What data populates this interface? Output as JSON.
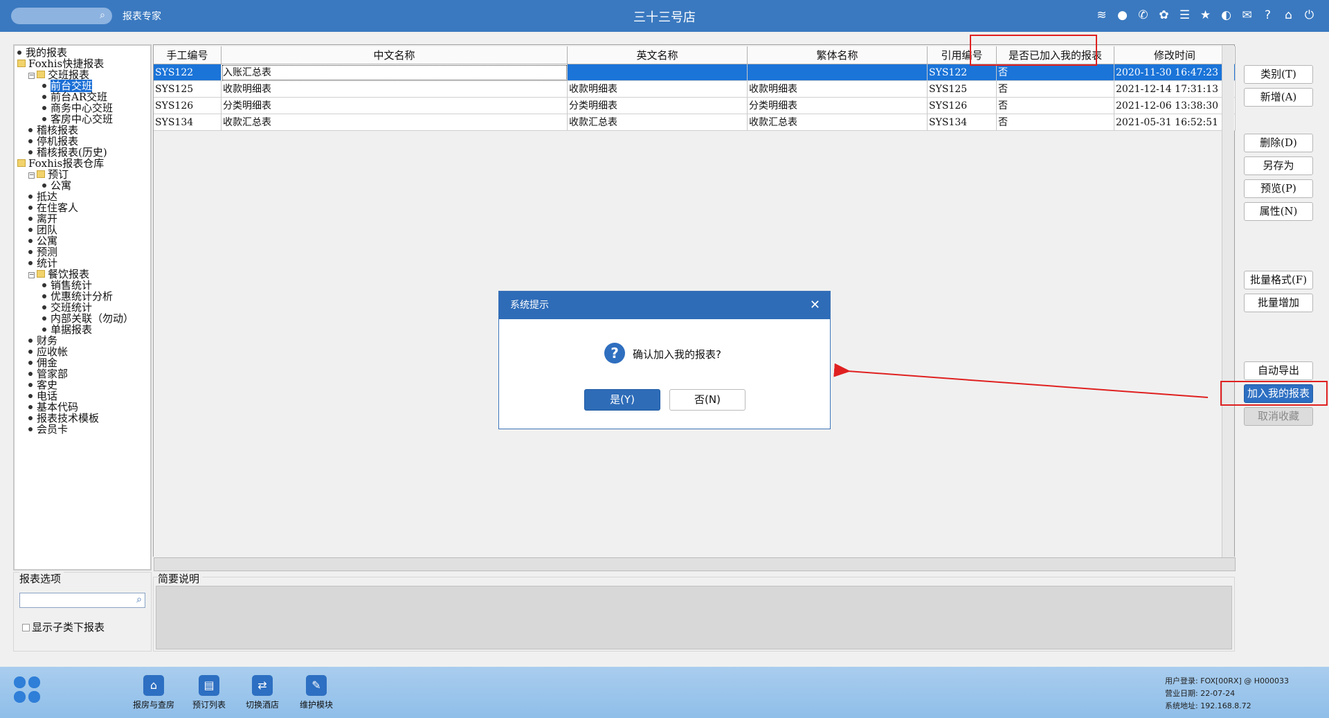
{
  "topbar": {
    "app_name": "报表专家",
    "hotel_name": "三十三号店",
    "icons": [
      "wifi-icon",
      "chat-icon",
      "phone-icon",
      "palette-icon",
      "menu-icon",
      "star-icon",
      "theme-icon",
      "mail-icon",
      "help-icon",
      "home-icon",
      "power-icon"
    ]
  },
  "tree": {
    "items": [
      {
        "label": "我的报表",
        "level": 0,
        "type": "leaf"
      },
      {
        "label": "Foxhis快捷报表",
        "level": 0,
        "type": "folder"
      },
      {
        "label": "交班报表",
        "level": 1,
        "type": "folder-open"
      },
      {
        "label": "前台交班",
        "level": 2,
        "type": "leaf",
        "selected": true
      },
      {
        "label": "前台AR交班",
        "level": 2,
        "type": "leaf"
      },
      {
        "label": "商务中心交班",
        "level": 2,
        "type": "leaf"
      },
      {
        "label": "客房中心交班",
        "level": 2,
        "type": "leaf"
      },
      {
        "label": "稽核报表",
        "level": 1,
        "type": "leaf"
      },
      {
        "label": "停机报表",
        "level": 1,
        "type": "leaf"
      },
      {
        "label": "稽核报表(历史)",
        "level": 1,
        "type": "leaf"
      },
      {
        "label": "Foxhis报表仓库",
        "level": 0,
        "type": "folder"
      },
      {
        "label": "预订",
        "level": 1,
        "type": "folder-open"
      },
      {
        "label": "公寓",
        "level": 2,
        "type": "leaf"
      },
      {
        "label": "抵达",
        "level": 1,
        "type": "leaf"
      },
      {
        "label": "在住客人",
        "level": 1,
        "type": "leaf"
      },
      {
        "label": "离开",
        "level": 1,
        "type": "leaf"
      },
      {
        "label": "团队",
        "level": 1,
        "type": "leaf"
      },
      {
        "label": "公寓",
        "level": 1,
        "type": "leaf"
      },
      {
        "label": "预测",
        "level": 1,
        "type": "leaf"
      },
      {
        "label": "统计",
        "level": 1,
        "type": "leaf"
      },
      {
        "label": "餐饮报表",
        "level": 1,
        "type": "folder-open"
      },
      {
        "label": "销售统计",
        "level": 2,
        "type": "leaf"
      },
      {
        "label": "优惠统计分析",
        "level": 2,
        "type": "leaf"
      },
      {
        "label": "交班统计",
        "level": 2,
        "type": "leaf"
      },
      {
        "label": "内部关联（勿动）",
        "level": 2,
        "type": "leaf"
      },
      {
        "label": "单据报表",
        "level": 2,
        "type": "leaf"
      },
      {
        "label": "财务",
        "level": 1,
        "type": "leaf"
      },
      {
        "label": "应收帐",
        "level": 1,
        "type": "leaf"
      },
      {
        "label": "佣金",
        "level": 1,
        "type": "leaf"
      },
      {
        "label": "管家部",
        "level": 1,
        "type": "leaf"
      },
      {
        "label": "客史",
        "level": 1,
        "type": "leaf"
      },
      {
        "label": "电话",
        "level": 1,
        "type": "leaf"
      },
      {
        "label": "基本代码",
        "level": 1,
        "type": "leaf"
      },
      {
        "label": "报表技术模板",
        "level": 1,
        "type": "leaf"
      },
      {
        "label": "会员卡",
        "level": 1,
        "type": "leaf"
      }
    ]
  },
  "grid": {
    "columns": [
      "手工编号",
      "中文名称",
      "英文名称",
      "繁体名称",
      "引用编号",
      "是否已加入我的报表",
      "修改时间"
    ],
    "rows": [
      [
        "SYS122",
        "入账汇总表",
        "",
        "",
        "SYS122",
        "否",
        "2020-11-30 16:47:23"
      ],
      [
        "SYS125",
        "收款明细表",
        "收款明细表",
        "收款明细表",
        "SYS125",
        "否",
        "2021-12-14 17:31:13"
      ],
      [
        "SYS126",
        "分类明细表",
        "分类明细表",
        "分类明细表",
        "SYS126",
        "否",
        "2021-12-06 13:38:30"
      ],
      [
        "SYS134",
        "收款汇总表",
        "收款汇总表",
        "收款汇总表",
        "SYS134",
        "否",
        "2021-05-31 16:52:51"
      ]
    ]
  },
  "buttons": {
    "category": "类别(T)",
    "add": "新增(A)",
    "delete": "删除(D)",
    "save_as": "另存为",
    "preview": "预览(P)",
    "properties": "属性(N)",
    "batch_format": "批量格式(F)",
    "batch_add": "批量增加",
    "auto_export": "自动导出",
    "add_to_my_reports": "加入我的报表",
    "unfavorite": "取消收藏"
  },
  "options": {
    "label": "报表选项",
    "search_value": "",
    "show_sub_label": "显示子类下报表"
  },
  "description": {
    "label": "简要说明"
  },
  "footer": {
    "items": [
      "报房与查房",
      "预订列表",
      "切换酒店",
      "维护模块"
    ],
    "status": {
      "user": "用户登录:  FOX[00RX] @ H000033",
      "date": "营业日期:  22-07-24",
      "address": "系统地址:  192.168.8.72"
    }
  },
  "dialog": {
    "title": "系统提示",
    "message": "确认加入我的报表?",
    "yes": "是(Y)",
    "no": "否(N)"
  },
  "colors": {
    "accent": "#2e6cb8",
    "highlight": "#e02020"
  }
}
